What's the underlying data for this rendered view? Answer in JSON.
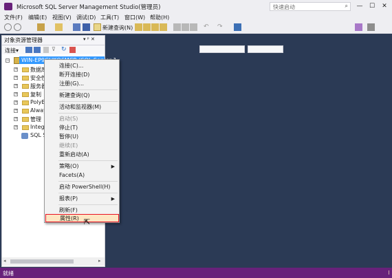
{
  "window": {
    "title": "Microsoft SQL Server Management Studio(管理员)",
    "quick_launch_placeholder": "快速启动",
    "minimize": "—",
    "maximize": "☐",
    "close": "✕"
  },
  "menu": [
    "文件(F)",
    "编辑(E)",
    "视图(V)",
    "调试(D)",
    "工具(T)",
    "窗口(W)",
    "帮助(H)"
  ],
  "toolbar": {
    "new_query_label": "新建查询(N)"
  },
  "object_explorer": {
    "title": "对象资源管理器",
    "pin": "▾ ᵖ ✕",
    "connect_label": "连接▾",
    "server": "WIN-EP9GUKQ6MCB (SQL Server 1",
    "nodes": [
      "数据库",
      "安全性",
      "服务器",
      "复制",
      "PolyBa",
      "Always",
      "管理",
      "Integra",
      "SQL Se"
    ]
  },
  "context_menu": {
    "items": [
      {
        "label": "连接(C)...",
        "disabled": false
      },
      {
        "label": "断开连接(D)",
        "disabled": false
      },
      {
        "label": "注册(G)...",
        "disabled": false
      },
      {
        "label": "新建查询(Q)",
        "disabled": false
      },
      {
        "label": "活动和监视器(M)",
        "disabled": false
      },
      {
        "label": "启动(S)",
        "disabled": true
      },
      {
        "label": "停止(T)",
        "disabled": false
      },
      {
        "label": "暂停(U)",
        "disabled": false
      },
      {
        "label": "继续(E)",
        "disabled": true
      },
      {
        "label": "重新启动(A)",
        "disabled": false
      },
      {
        "label": "策略(O)",
        "disabled": false
      },
      {
        "label": "Facets(A)",
        "disabled": false
      },
      {
        "label": "启动 PowerShell(H)",
        "disabled": false
      },
      {
        "label": "报表(P)",
        "disabled": false
      },
      {
        "label": "刷新(F)",
        "disabled": false
      },
      {
        "label": "属性(R)",
        "disabled": false
      }
    ]
  },
  "status": {
    "text": "就绪"
  },
  "colors": {
    "accent": "#68217a",
    "selection": "#3399ff",
    "background": "#2b3a55"
  }
}
